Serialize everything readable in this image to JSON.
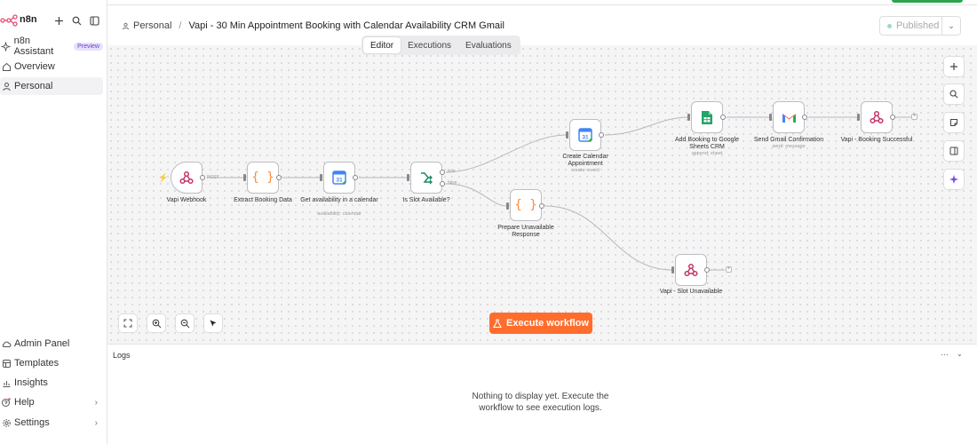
{
  "app": {
    "brand": "n8n"
  },
  "sidebar": {
    "assistant": {
      "label": "n8n Assistant",
      "badge": "Preview"
    },
    "items": [
      {
        "label": "Overview"
      },
      {
        "label": "Personal"
      }
    ],
    "bottom_items": [
      {
        "label": "Admin Panel"
      },
      {
        "label": "Templates"
      },
      {
        "label": "Insights"
      },
      {
        "label": "Help"
      },
      {
        "label": "Settings"
      }
    ]
  },
  "header": {
    "breadcrumb_project": "Personal",
    "workflow_name": "Vapi - 30 Min Appointment Booking with Calendar Availability CRM Gmail",
    "more": "···",
    "published_label": "Published",
    "tabs": [
      {
        "label": "Editor"
      },
      {
        "label": "Executions"
      },
      {
        "label": "Evaluations"
      }
    ]
  },
  "canvas": {
    "nodes": [
      {
        "label": "Vapi Webhook",
        "sub": ""
      },
      {
        "label": "Extract Booking Data",
        "sub": ""
      },
      {
        "label": "Get availability in a calendar",
        "sub": "availability: calendar"
      },
      {
        "label": "Is Slot Available?",
        "sub": ""
      },
      {
        "label": "Create Calendar Appointment",
        "sub": "create: event"
      },
      {
        "label": "Prepare Unavailable Response",
        "sub": ""
      },
      {
        "label": "Add Booking to Google Sheets CRM",
        "sub": "append: sheet"
      },
      {
        "label": "Send Gmail Confirmation",
        "sub": "send: message"
      },
      {
        "label": "Vapi - Booking Successful",
        "sub": ""
      },
      {
        "label": "Vapi - Slot Unavailable",
        "sub": ""
      }
    ],
    "edge_labels": {
      "post": "POST",
      "true": "true",
      "false": "false"
    },
    "execute_label": "Execute workflow"
  },
  "logs": {
    "title": "Logs",
    "more": "···",
    "empty_message": "Nothing to display yet. Execute the workflow to see execution logs."
  }
}
